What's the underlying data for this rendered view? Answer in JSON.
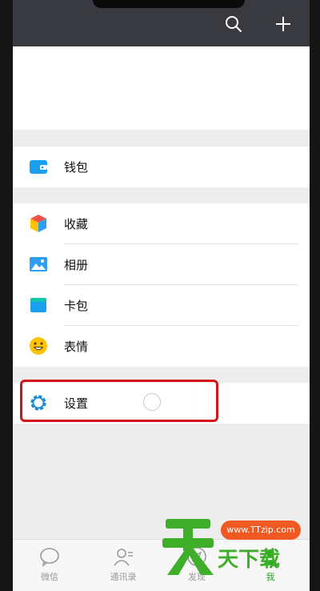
{
  "menu": {
    "wallet": {
      "label": "钱包",
      "icon": "wallet-icon"
    },
    "favorites": {
      "label": "收藏",
      "icon": "favorites-cube-icon"
    },
    "album": {
      "label": "相册",
      "icon": "album-icon"
    },
    "cards": {
      "label": "卡包",
      "icon": "card-pack-icon"
    },
    "stickers": {
      "label": "表情",
      "icon": "smiley-icon"
    },
    "settings": {
      "label": "设置",
      "icon": "settings-gear-icon"
    }
  },
  "tabs": [
    {
      "label": "微信",
      "icon": "chat-bubble-icon",
      "active": false
    },
    {
      "label": "通讯录",
      "icon": "contacts-icon",
      "active": false
    },
    {
      "label": "发现",
      "icon": "compass-icon",
      "active": false
    },
    {
      "label": "我",
      "icon": "me-icon",
      "active": true
    }
  ],
  "watermark": {
    "url": "www.TTzip.com",
    "text": "天下载",
    "logo_char": "天"
  },
  "colors": {
    "topbar": "#393a3f",
    "accent_green": "#1aad19",
    "highlight_red": "#d3141b",
    "watermark_orange": "#f05a22",
    "watermark_green": "#3fae2a"
  }
}
